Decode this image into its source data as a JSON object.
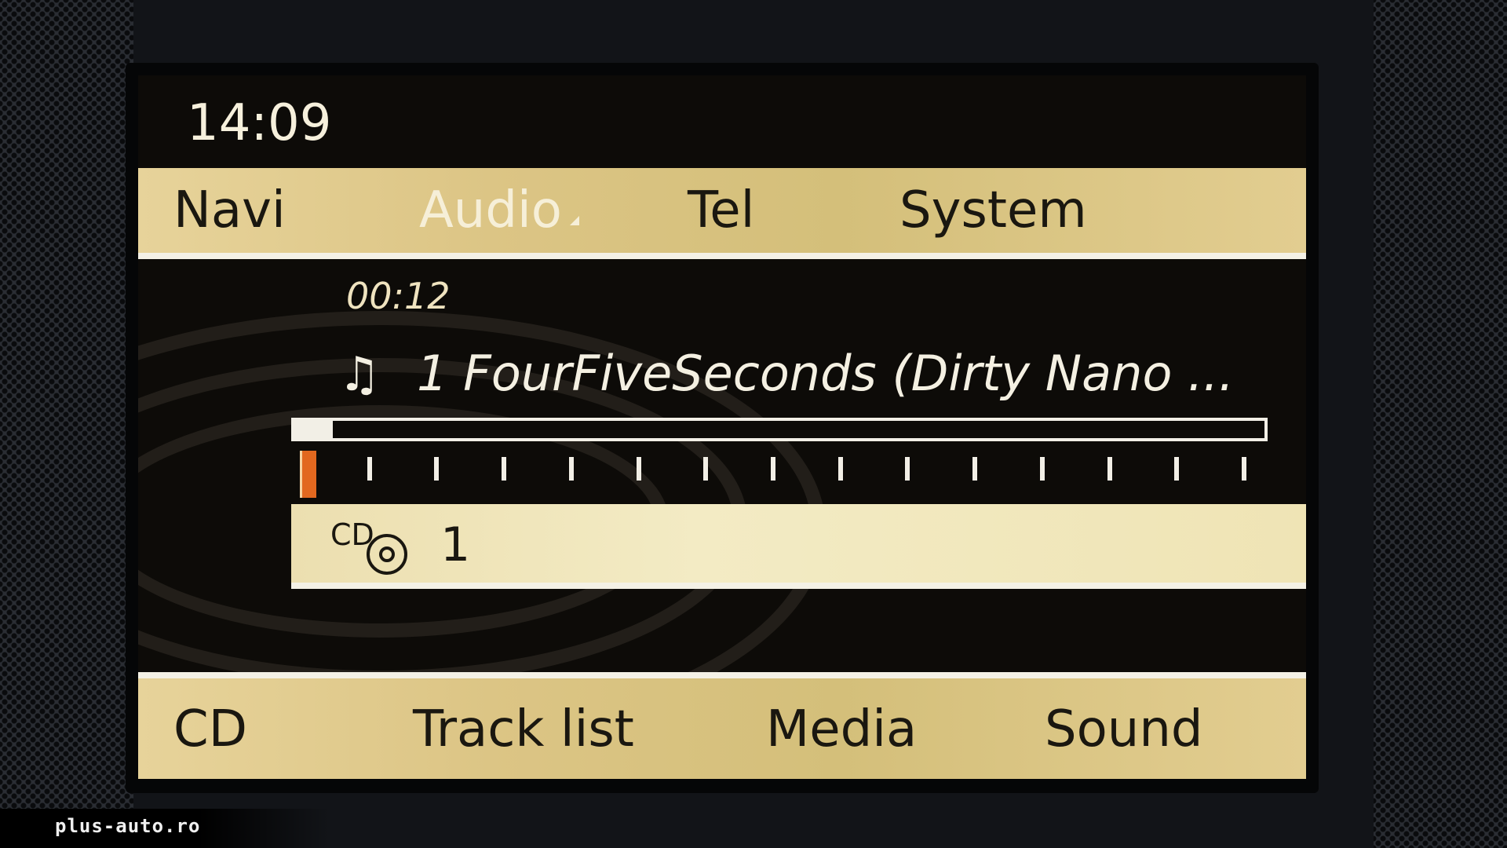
{
  "status": {
    "clock": "14:09"
  },
  "top_menu": {
    "items": [
      {
        "label": "Navi"
      },
      {
        "label": "Audio",
        "active": true
      },
      {
        "label": "Tel"
      },
      {
        "label": "System"
      }
    ]
  },
  "now_playing": {
    "elapsed": "00:12",
    "icon": "music-note-icon",
    "track_title": "1 FourFiveSeconds (Dirty Nano ...",
    "progress": 0.04,
    "track_ticks": 15,
    "current_track_index": 0
  },
  "source": {
    "icon": "cd-icon",
    "icon_text": "CD",
    "disc_number": "1"
  },
  "bottom_menu": {
    "items": [
      {
        "label": "CD"
      },
      {
        "label": "Track list"
      },
      {
        "label": "Media"
      },
      {
        "label": "Sound"
      }
    ]
  },
  "watermark": {
    "text": "plus-auto.ro"
  },
  "colors": {
    "menu_bar": "#dcc585",
    "active_label": "#f6efd8",
    "current_tick": "#e2681f",
    "screen_bg": "#0d0b08"
  }
}
